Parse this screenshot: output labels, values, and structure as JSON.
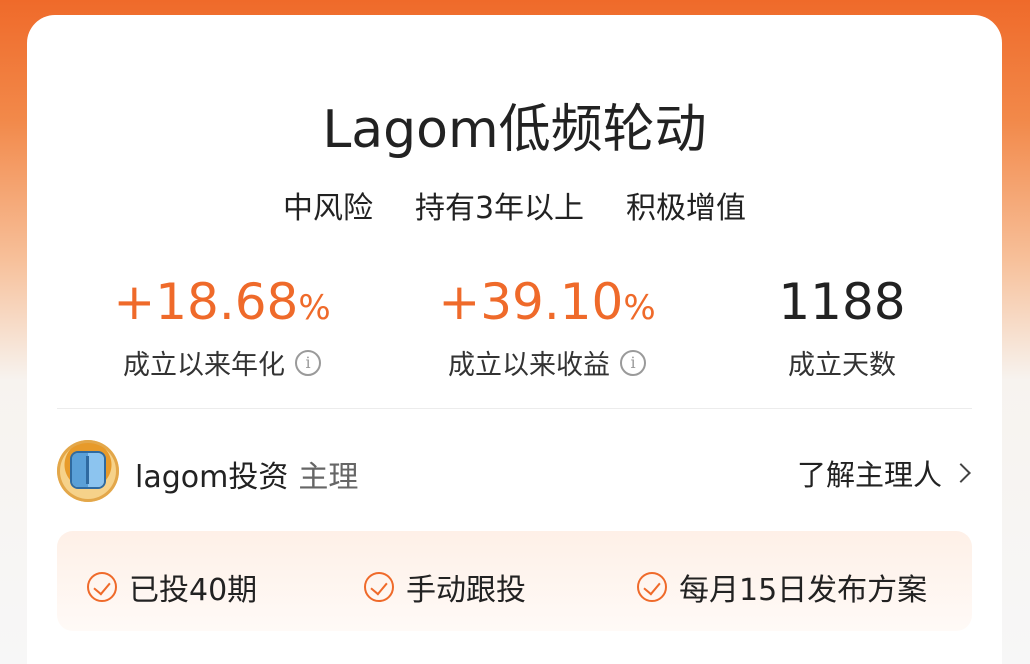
{
  "product": {
    "title": "Lagom低频轮动",
    "tags": [
      "中风险",
      "持有3年以上",
      "积极增值"
    ]
  },
  "stats": {
    "annualized": {
      "value": "+18.68",
      "unit": "%",
      "label": "成立以来年化"
    },
    "total_return": {
      "value": "+39.10",
      "unit": "%",
      "label": "成立以来收益"
    },
    "days": {
      "value": "1188",
      "label": "成立天数"
    }
  },
  "manager": {
    "name": "lagom投资",
    "role": "主理",
    "link_label": "了解主理人"
  },
  "features": [
    "已投40期",
    "手动跟投",
    "每月15日发布方案"
  ],
  "colors": {
    "accent": "#ef6a2a",
    "tag_highlight": "#fde9de"
  }
}
